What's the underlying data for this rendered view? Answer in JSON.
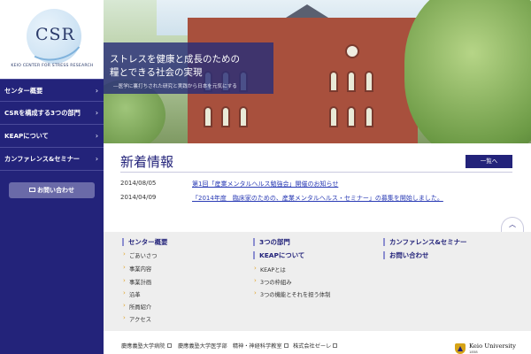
{
  "logo": {
    "mark": "CSR",
    "subtitle": "KEIO CENTER FOR STRESS RESEARCH"
  },
  "sidebar": {
    "items": [
      {
        "label": "センター概要",
        "icon": "chevron-right-icon"
      },
      {
        "label": "CSRを構成する3つの部門",
        "icon": "chevron-right-icon"
      },
      {
        "label": "KEAPについて",
        "icon": "chevron-right-icon"
      },
      {
        "label": "カンファレンス&セミナー",
        "icon": "chevron-right-icon"
      }
    ],
    "contact_label": "お問い合わせ",
    "contact_icon": "mail-icon"
  },
  "hero": {
    "title_line1": "ストレスを健康と成長のための",
    "title_line2": "糧とできる社会の実現",
    "subtitle": "―医学に裏打ちされた研究と実践から日本を元気にする"
  },
  "news": {
    "title": "新着情報",
    "more_label": "一覧へ",
    "items": [
      {
        "date": "2014/08/05",
        "text": "第1回「産業メンタルヘルス勉強会」開催のお知らせ"
      },
      {
        "date": "2014/04/09",
        "text": "「2014年度　臨床家のための、産業メンタルヘルス・セミナー」の募集を開始しました。"
      }
    ],
    "top_icon": "chevron-up-icon"
  },
  "sitemap": {
    "col1": {
      "head": "センター概要",
      "items": [
        "ごあいさつ",
        "事業内容",
        "事業計画",
        "沿革",
        "所員紹介",
        "アクセス"
      ]
    },
    "col2": {
      "head1": "3つの部門",
      "head2": "KEAPについて",
      "items": [
        "KEAPとは",
        "3つの枠組み",
        "3つの機能とそれを担う体制"
      ]
    },
    "col3": {
      "head1": "カンファレンス&セミナー",
      "head2": "お問い合わせ"
    }
  },
  "footer": {
    "links": [
      "慶應義塾大学病院",
      "慶應義塾大学医学部　精神・神経科学教室",
      "株式会社ゼーレ"
    ],
    "university": "Keio University",
    "university_sub": "1858"
  },
  "colors": {
    "brand": "#23237a",
    "link": "#2a3bb5",
    "accent": "#e0a020"
  }
}
